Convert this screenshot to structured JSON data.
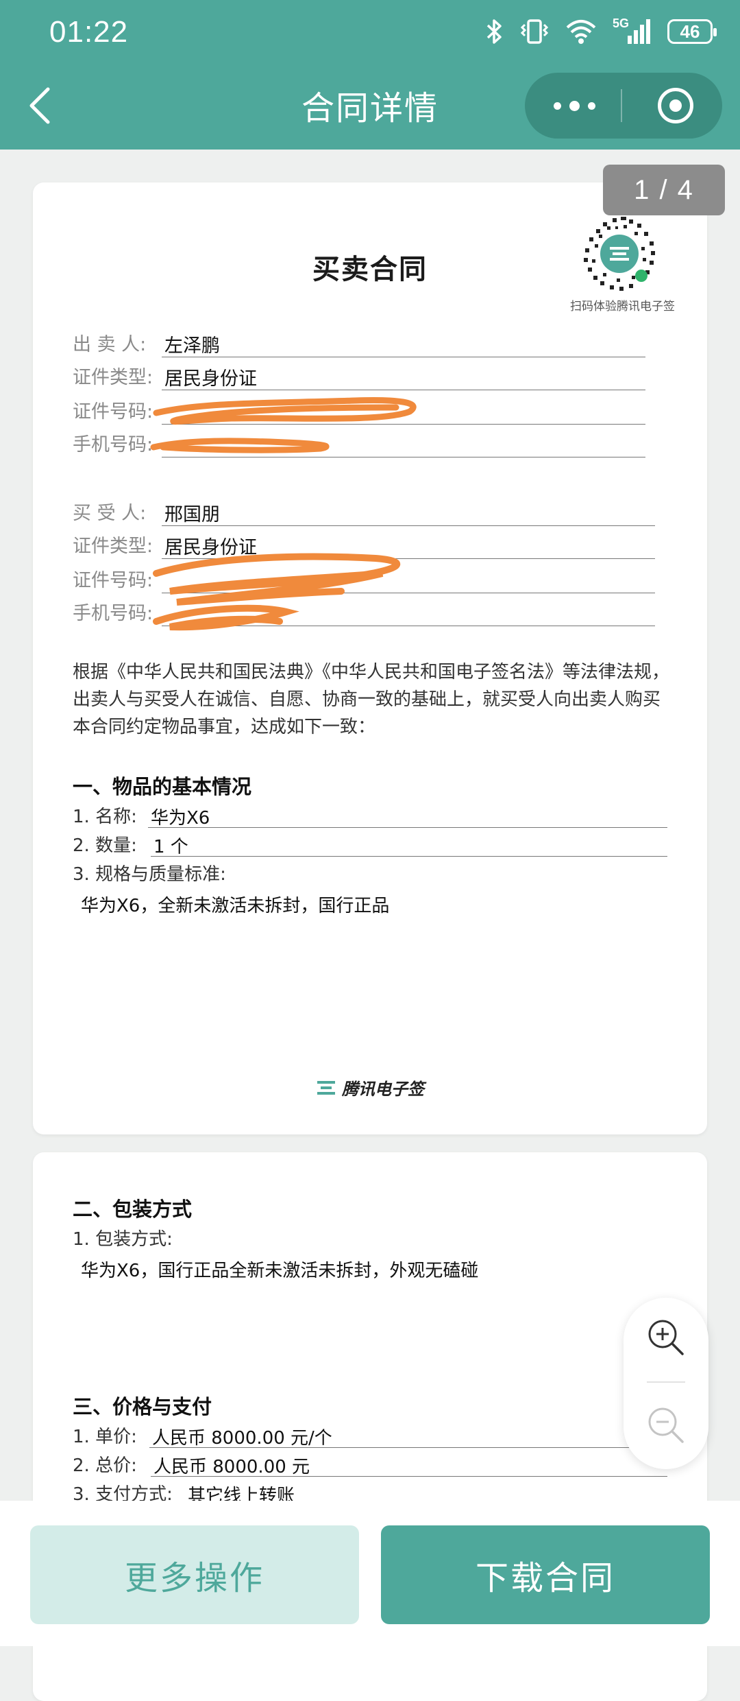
{
  "status_bar": {
    "time": "01:22",
    "battery": "46",
    "network": "5G"
  },
  "nav": {
    "title": "合同详情"
  },
  "page_indicator": "1 / 4",
  "qr": {
    "caption": "扫码体验腾讯电子签"
  },
  "contract": {
    "title": "买卖合同",
    "seller": [
      {
        "label": "出 卖 人:",
        "value": "左泽鹏"
      },
      {
        "label": "证件类型:",
        "value": "居民身份证"
      },
      {
        "label": "证件号码:",
        "value": ""
      },
      {
        "label": "手机号码:",
        "value": ""
      }
    ],
    "buyer": [
      {
        "label": "买 受 人:",
        "value": "邢国朋"
      },
      {
        "label": "证件类型:",
        "value": "居民身份证"
      },
      {
        "label": "证件号码:",
        "value": ""
      },
      {
        "label": "手机号码:",
        "value": ""
      }
    ],
    "intro": "根据《中华人民共和国民法典》《中华人民共和国电子签名法》等法律法规，出卖人与买受人在诚信、自愿、协商一致的基础上，就买受人向出卖人购买本合同约定物品事宜，达成如下一致：",
    "section1": {
      "heading": "一、物品的基本情况",
      "name_label": "1. 名称:",
      "name_value": "华为X6",
      "qty_label": "2. 数量:",
      "qty_value": "1 个",
      "spec_label": "3. 规格与质量标准:",
      "spec_value": "华为X6，全新未激活未拆封，国行正品"
    },
    "brand": "腾讯电子签",
    "section2": {
      "heading": "二、包装方式",
      "pack_label": "1. 包装方式:",
      "pack_value": "华为X6，国行正品全新未激活未拆封，外观无磕碰"
    },
    "section3": {
      "heading": "三、价格与支付",
      "unit_label": "1. 单价:",
      "unit_value": "人民币 8000.00 元/个",
      "total_label": "2. 总价:",
      "total_value": "人民币 8000.00 元",
      "pay_label": "3. 支付方式:",
      "pay_value": "其它线上转账"
    }
  },
  "actions": {
    "more": "更多操作",
    "download": "下载合同"
  },
  "colors": {
    "brand": "#4ea89b",
    "scribble": "#f08a3c"
  }
}
